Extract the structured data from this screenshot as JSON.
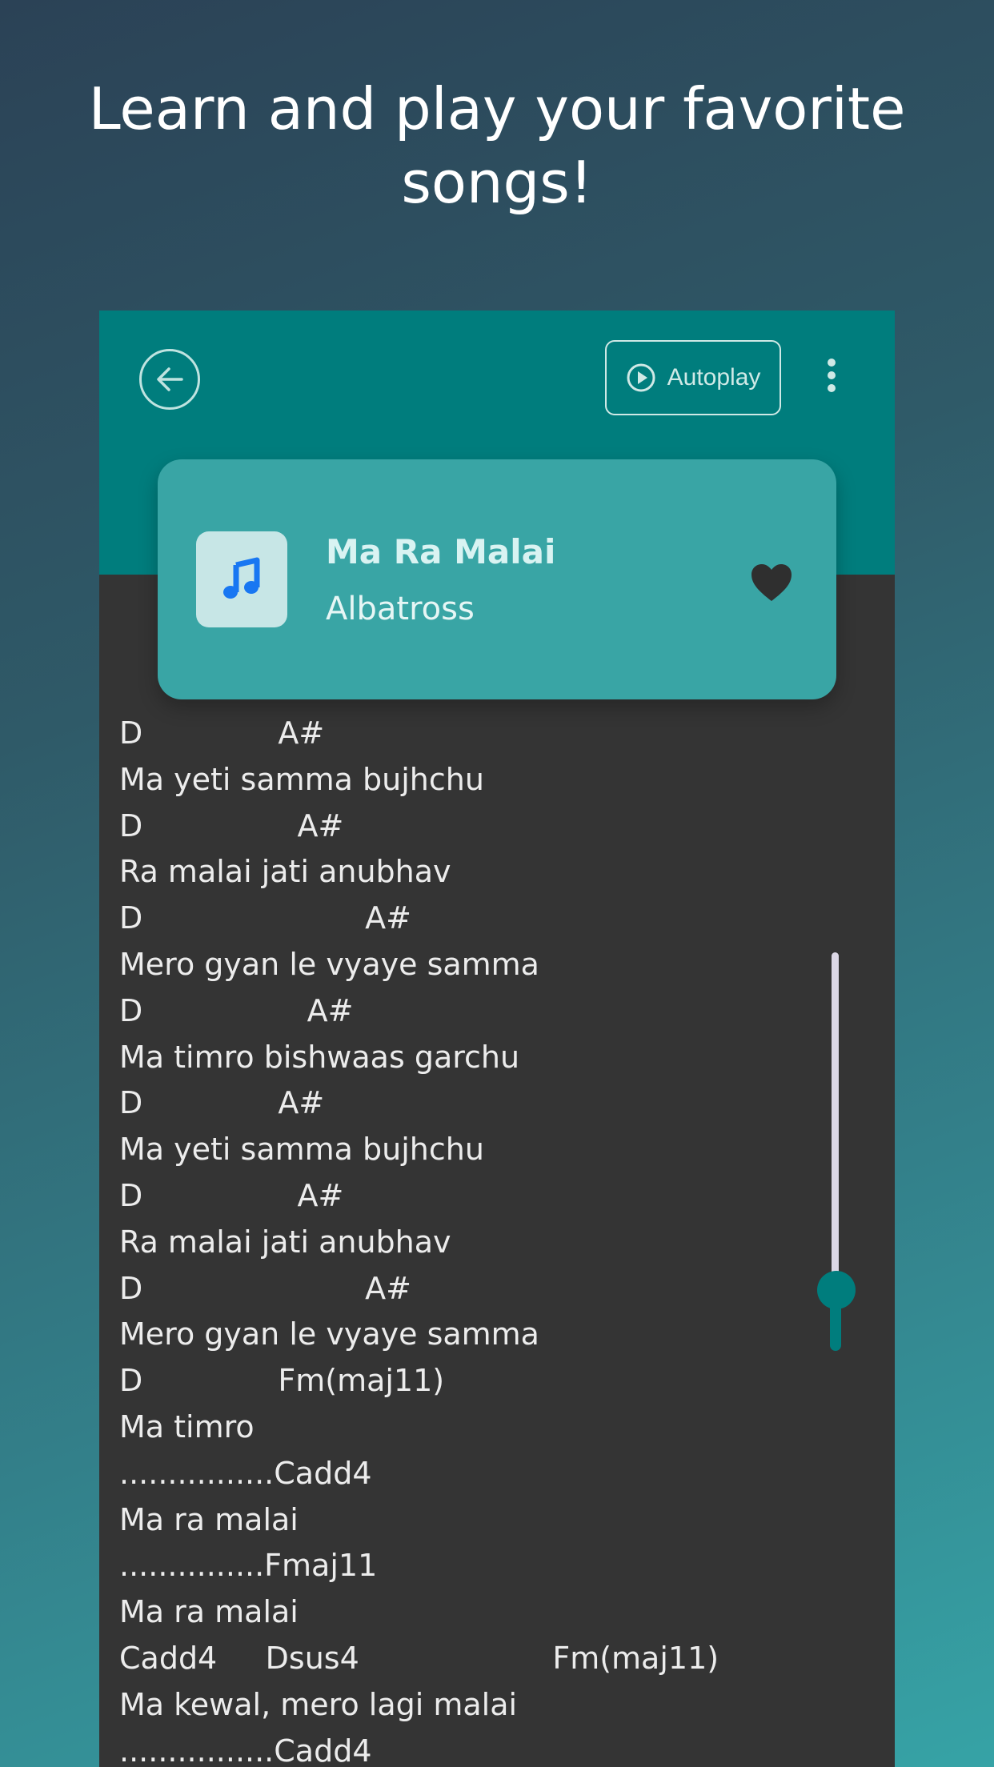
{
  "headline": {
    "line1": "Learn and play your favorite",
    "line2": "songs!"
  },
  "toolbar": {
    "back_icon": "arrow-left-circle-icon",
    "autoplay_label": "Autoplay",
    "more_icon": "more-vertical-icon"
  },
  "song": {
    "title": "Ma Ra Malai",
    "artist": "Albatross",
    "favorite": true
  },
  "lyrics": [
    "D              A#",
    "Ma yeti samma bujhchu",
    "D                A#",
    "Ra malai jati anubhav",
    "D                       A#",
    "Mero gyan le vyaye samma",
    "D                 A#",
    "Ma timro bishwaas garchu",
    "D              A#",
    "Ma yeti samma bujhchu",
    "D                A#",
    "Ra malai jati anubhav",
    "D                       A#",
    "Mero gyan le vyaye samma",
    "D              Fm(maj11)",
    "Ma timro",
    "................Cadd4",
    "Ma ra malai",
    "...............Fmaj11",
    "Ma ra malai",
    "Cadd4     Dsus4                    Fm(maj11)",
    "Ma kewal, mero lagi malai",
    "................Cadd4"
  ],
  "scroll": {
    "position": 0.78
  },
  "colors": {
    "accent": "#007d7d",
    "card": "#39a5a5",
    "lyrics_bg": "#343434",
    "heart": "#2f2f2f",
    "music_note": "#1877f2"
  }
}
